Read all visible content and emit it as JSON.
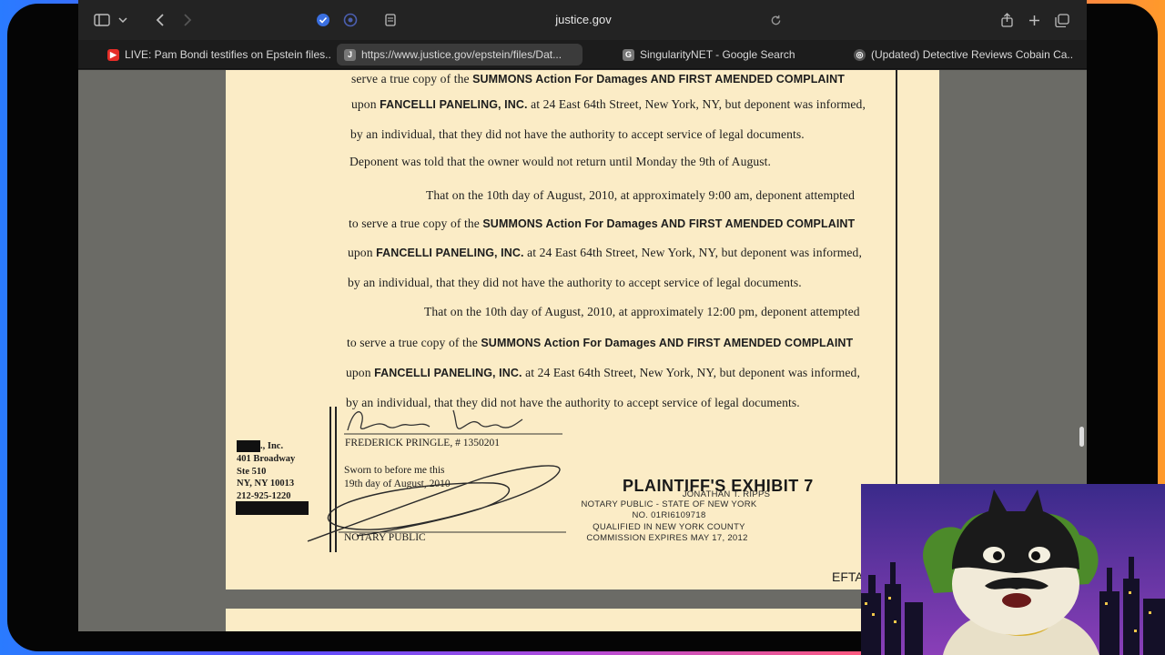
{
  "toolbar": {
    "address": "justice.gov"
  },
  "tabs": [
    {
      "label": "LIVE: Pam Bondi testifies on Epstein files...",
      "favicon": "youtube-icon"
    },
    {
      "label": "https://www.justice.gov/epstein/files/Dat...",
      "favicon": "J"
    },
    {
      "label": "SingularityNET - Google Search",
      "favicon": "G"
    },
    {
      "label": "(Updated) Detective Reviews Cobain Ca...",
      "favicon": "globe-icon"
    }
  ],
  "document": {
    "p1_line1_a": "serve a true copy of the ",
    "p1_line1_b": "SUMMONS Action For Damages AND FIRST AMENDED COMPLAINT",
    "p1_line2_a": "upon ",
    "p1_line2_b": "FANCELLI PANELING, INC.",
    "p1_line2_c": " at 24 East 64th Street, New York, NY, but deponent was informed,",
    "p1_line3": "by an individual, that they did not have the authority to accept service of legal documents.",
    "p1_line4": "Deponent was told that the owner would not return until Monday the 9th of August.",
    "p2_line1": "That on the 10th day of August, 2010, at approximately 9:00 am, deponent attempted",
    "p2_line2_a": "to serve a true copy of the ",
    "p2_line2_b": "SUMMONS Action For Damages AND FIRST AMENDED COMPLAINT",
    "p2_line3_a": "upon ",
    "p2_line3_b": "FANCELLI PANELING, INC.",
    "p2_line3_c": " at 24 East 64th Street, New York, NY, but deponent was informed,",
    "p2_line4": "by an individual, that they did not have the authority to accept service of legal documents.",
    "p3_line1": "That on the 10th day of August, 2010, at approximately 12:00 pm, deponent attempted",
    "p3_line2_a": "to serve a true copy of the ",
    "p3_line2_b": "SUMMONS Action For Damages AND FIRST AMENDED COMPLAINT",
    "p3_line3_a": "upon ",
    "p3_line3_b": "FANCELLI PANELING, INC.",
    "p3_line3_c": " at 24 East 64th Street, New York, NY, but deponent was informed,",
    "p3_line4": "by an individual, that they did not have the authority to accept service of legal documents.",
    "signature": "Frederick Pringle",
    "signer_name": "FREDERICK PRINGLE, # 1350201",
    "company_suffix": "., Inc.",
    "company_addr1": "401 Broadway",
    "company_addr2": "Ste 510",
    "company_addr3": "NY, NY 10013",
    "company_phone": "212-925-1220",
    "sworn1": "Sworn to before me this",
    "sworn2": "19th day of August, 2010",
    "notary_label": "NOTARY PUBLIC",
    "exhibit": "PLAINTIFF'S EXHIBIT 7",
    "stamp1": "JONATHAN T. RIPPS",
    "stamp2": "NOTARY PUBLIC - STATE OF NEW YORK",
    "stamp3": "NO. 01RI6109718",
    "stamp4": "QUALIFIED IN NEW YORK COUNTY",
    "stamp5": "COMMISSION EXPIRES MAY 17, 2012",
    "bates": "EFTA"
  },
  "colors": {
    "page": "#fbecc6",
    "viewer_bg": "#6b6b66",
    "frame_gradient_start": "#2a7bff",
    "frame_gradient_end": "#ff9a2a"
  }
}
